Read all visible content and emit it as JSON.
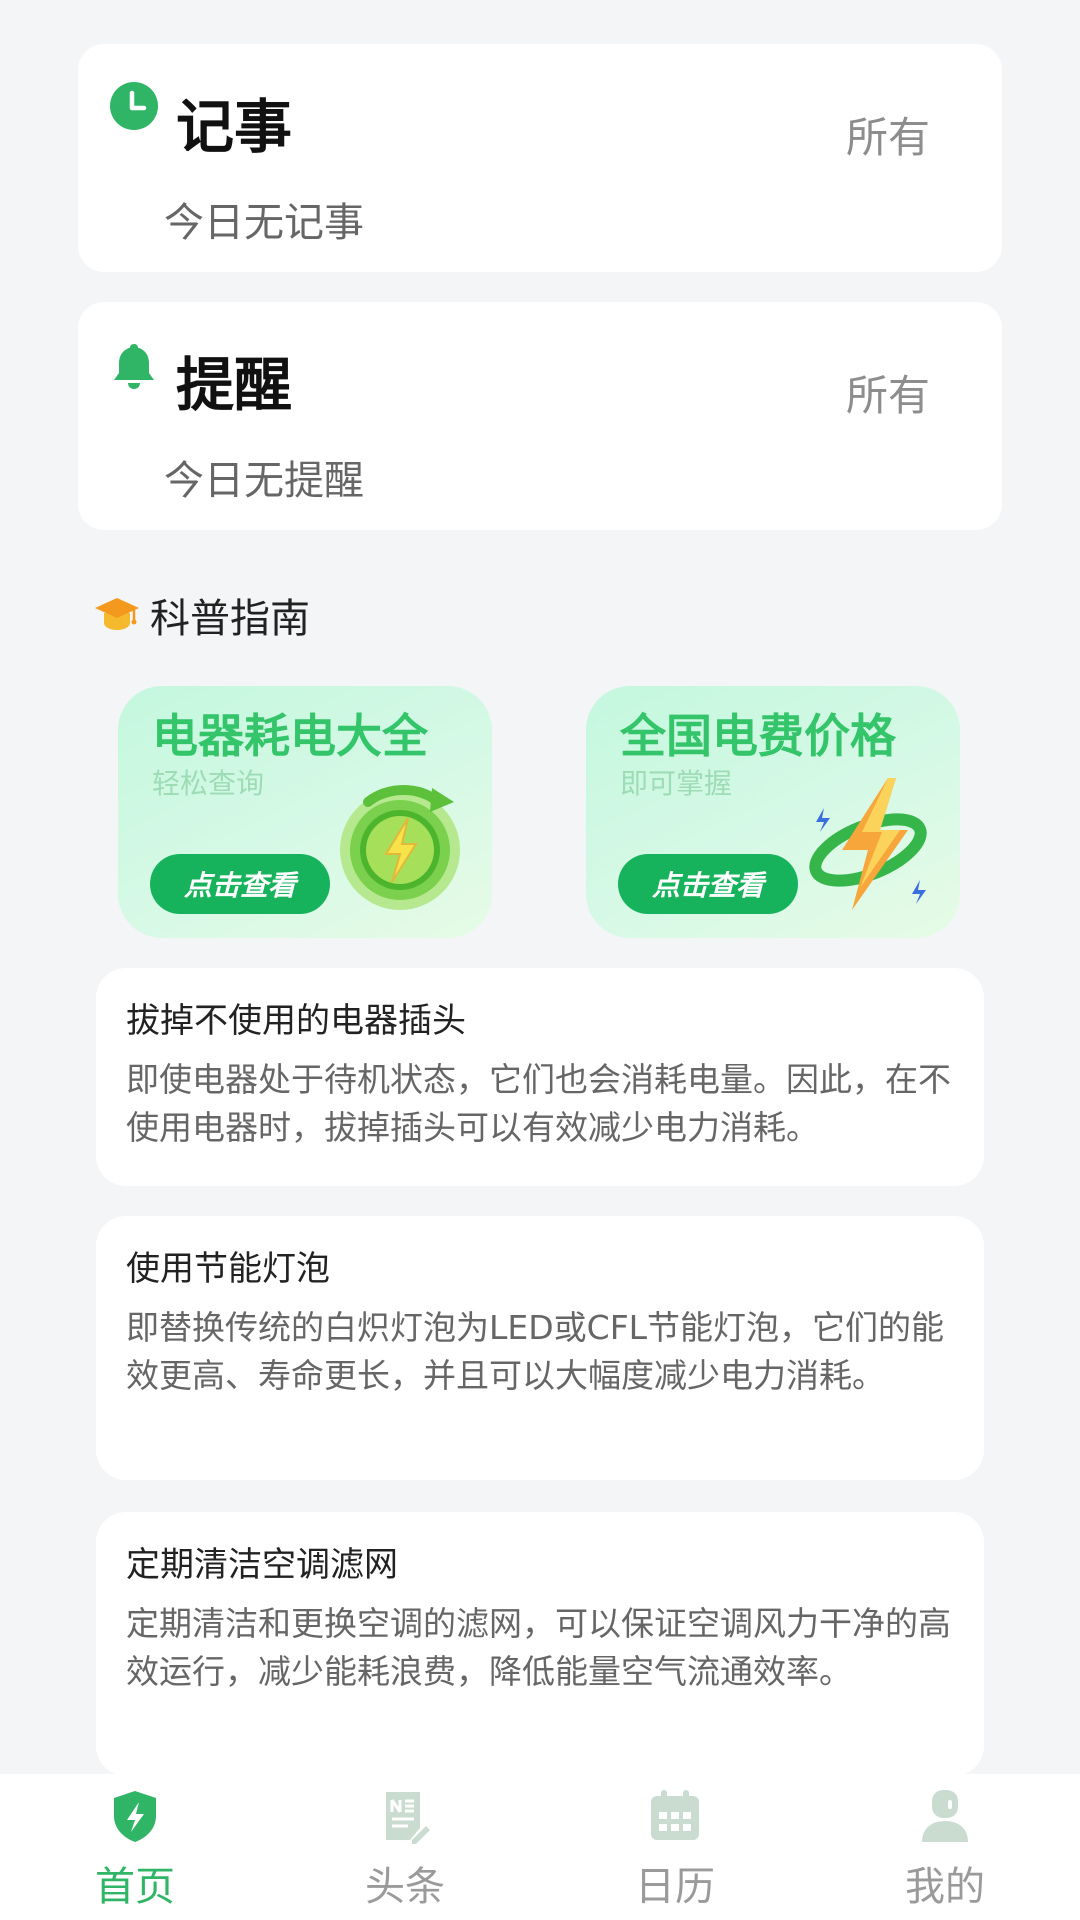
{
  "notes_card": {
    "title": "记事",
    "link": "所有",
    "empty_text": "今日无记事"
  },
  "reminders_card": {
    "title": "提醒",
    "link": "所有",
    "empty_text": "今日无提醒"
  },
  "guide_section": {
    "title": "科普指南"
  },
  "promos": [
    {
      "title": "电器耗电大全",
      "subtitle": "轻松查询",
      "button": "点击查看",
      "icon": "recycle-lightning-icon"
    },
    {
      "title": "全国电费价格",
      "subtitle": "即可掌握",
      "button": "点击查看",
      "icon": "lightning-ring-icon"
    }
  ],
  "tips": [
    {
      "title": "拔掉不使用的电器插头",
      "body": "即使电器处于待机状态，它们也会消耗电量。因此，在不使用电器时，拔掉插头可以有效减少电力消耗。"
    },
    {
      "title": "使用节能灯泡",
      "body": "即替换传统的白炽灯泡为LED或CFL节能灯泡，它们的能效更高、寿命更长，并且可以大幅度减少电力消耗。"
    },
    {
      "title": "定期清洁空调滤网",
      "body": "定期清洁和更换空调的滤网，可以保证空调风力干净的高效运行，减少能耗浪费，降低能量空气流通效率。"
    }
  ],
  "tabbar": {
    "active": "首页",
    "items": [
      {
        "label": "首页",
        "icon": "shield-bolt-icon"
      },
      {
        "label": "头条",
        "icon": "news-icon"
      },
      {
        "label": "日历",
        "icon": "calendar-icon"
      },
      {
        "label": "我的",
        "icon": "profile-icon"
      }
    ]
  },
  "colors": {
    "accent": "#2fb565",
    "button": "#16b25c",
    "promo_title": "#34c46a",
    "background": "#f4f5f7"
  }
}
